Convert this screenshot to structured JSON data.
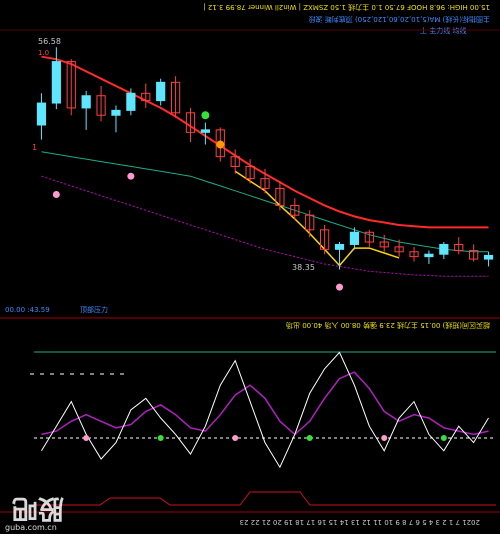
{
  "colors": {
    "background": "#000000",
    "up_candle": "#5fe6ff",
    "down_candle": "#ff4040",
    "ma_upper": "#ff2a2a",
    "ma_mid": "#ff4040",
    "ma_lower": "#c400c4",
    "trend_segment": "#ffd400",
    "channel_green": "#1faa8a",
    "osc_white": "#ffffff",
    "osc_purple": "#b020c0",
    "osc_red": "#d01020",
    "text_gray": "#c8c8c8",
    "text_blue": "#3c8cff",
    "text_yellow": "#f0e000",
    "text_magenta": "#ff3cff",
    "text_green": "#36e036",
    "text_red": "#ff4040"
  },
  "texts": {
    "top_bar": "15.00 HIGH: 96.8 HOOF 67.50 1.0 主力线 1.50 ZSMXZ | Win2ll Winner 78.99 3.12 |",
    "legend_line_1": "主图指标(长线) MA(5,10,20,60,120,250) 顶底判断 波段",
    "legend_line_2": "上 主力线 均线",
    "price_high_label": "56.58",
    "price_low_label": "38.35",
    "price_tag_2": "1.0",
    "left_scale_label": "1",
    "bottom_left_pane_label": "00.00 :43.59",
    "bottom_mid_label": "顶部压力",
    "osc_top_bar": "超买区间(短线) 00.15 主力线 23.9 强势 08.00 入场 40.00 出场",
    "date_axis": "2021 7 1 2 3 4 5 6 7 8 9 10 11 12 13 14 15 16 17 18 19 20 21 22 23",
    "watermark_big": "股吧",
    "watermark_url": "guba.com.cn"
  },
  "chart_data": [
    {
      "type": "candlestick",
      "title": "",
      "ohlc": [
        [
          50.2,
          52.8,
          49.0,
          52.0
        ],
        [
          52.0,
          56.58,
          51.5,
          55.4
        ],
        [
          55.4,
          55.6,
          51.0,
          51.6
        ],
        [
          51.6,
          53.0,
          49.8,
          52.6
        ],
        [
          52.6,
          53.4,
          50.5,
          51.0
        ],
        [
          51.0,
          51.8,
          49.6,
          51.4
        ],
        [
          51.4,
          53.2,
          51.0,
          52.8
        ],
        [
          52.8,
          53.6,
          51.6,
          52.2
        ],
        [
          52.2,
          54.0,
          51.8,
          53.7
        ],
        [
          53.7,
          54.2,
          50.8,
          51.2
        ],
        [
          51.2,
          51.6,
          48.8,
          49.6
        ],
        [
          49.6,
          50.4,
          48.6,
          49.8
        ],
        [
          49.8,
          50.0,
          47.2,
          47.6
        ],
        [
          47.6,
          48.2,
          46.2,
          46.8
        ],
        [
          46.8,
          47.4,
          45.4,
          45.8
        ],
        [
          45.8,
          46.6,
          44.6,
          45.0
        ],
        [
          45.0,
          45.6,
          43.2,
          43.6
        ],
        [
          43.6,
          44.2,
          42.4,
          42.8
        ],
        [
          42.8,
          43.2,
          41.0,
          41.6
        ],
        [
          41.6,
          42.0,
          39.6,
          40.0
        ],
        [
          40.0,
          40.6,
          38.35,
          40.4
        ],
        [
          40.4,
          41.8,
          40.0,
          41.4
        ],
        [
          41.4,
          41.6,
          40.2,
          40.6
        ],
        [
          40.6,
          41.2,
          39.8,
          40.2
        ],
        [
          40.2,
          40.8,
          39.4,
          39.8
        ],
        [
          39.8,
          40.2,
          39.0,
          39.4
        ],
        [
          39.4,
          39.9,
          38.8,
          39.6
        ],
        [
          39.6,
          40.6,
          39.2,
          40.4
        ],
        [
          40.4,
          41.0,
          39.6,
          39.9
        ],
        [
          39.9,
          40.4,
          39.0,
          39.2
        ],
        [
          39.2,
          39.8,
          38.6,
          39.5
        ]
      ],
      "ma_upper": [
        55.8,
        55.6,
        55.2,
        54.6,
        54.0,
        53.4,
        52.8,
        52.2,
        51.6,
        50.9,
        50.1,
        49.3,
        48.5,
        47.7,
        46.9,
        46.2,
        45.5,
        44.8,
        44.2,
        43.6,
        43.1,
        42.7,
        42.4,
        42.2,
        42.0,
        41.9,
        41.8,
        41.8,
        41.8,
        41.8,
        41.8
      ],
      "ma_lower": [
        46.0,
        45.6,
        45.2,
        44.8,
        44.4,
        44.0,
        43.6,
        43.2,
        42.8,
        42.4,
        42.0,
        41.6,
        41.2,
        40.8,
        40.4,
        40.0,
        39.7,
        39.4,
        39.1,
        38.8,
        38.6,
        38.4,
        38.2,
        38.1,
        38.0,
        37.9,
        37.85,
        37.8,
        37.8,
        37.8,
        37.8
      ],
      "channel_green": [
        48.0,
        47.8,
        47.6,
        47.4,
        47.2,
        47.0,
        46.8,
        46.6,
        46.4,
        46.2,
        46.0,
        45.6,
        45.2,
        44.8,
        44.4,
        44.0,
        43.6,
        43.2,
        42.8,
        42.4,
        42.0,
        41.6,
        41.2,
        40.9,
        40.6,
        40.4,
        40.2,
        40.0,
        39.9,
        39.8,
        39.8
      ],
      "price_markers": [
        "56.58",
        "38.35"
      ]
    },
    {
      "type": "line",
      "title": "",
      "series": [
        {
          "name": "osc_white",
          "values": [
            30,
            45,
            60,
            40,
            25,
            35,
            55,
            62,
            50,
            40,
            28,
            45,
            70,
            85,
            60,
            35,
            20,
            40,
            65,
            80,
            90,
            70,
            45,
            30,
            50,
            60,
            40,
            30,
            45,
            35,
            50
          ]
        },
        {
          "name": "osc_purple",
          "values": [
            40,
            42,
            48,
            52,
            48,
            44,
            46,
            54,
            58,
            52,
            44,
            42,
            52,
            64,
            70,
            62,
            48,
            40,
            48,
            62,
            74,
            78,
            68,
            54,
            48,
            52,
            50,
            44,
            42,
            40,
            42
          ]
        }
      ],
      "markers": [
        "S",
        "B"
      ]
    }
  ]
}
